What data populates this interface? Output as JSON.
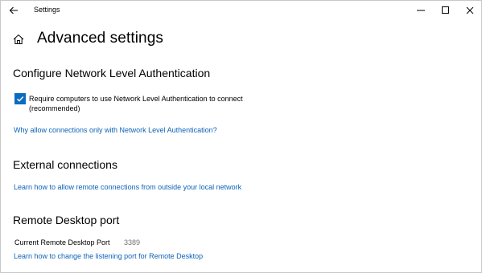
{
  "window": {
    "title": "Settings"
  },
  "page": {
    "title": "Advanced settings"
  },
  "nla": {
    "heading": "Configure Network Level Authentication",
    "checkbox_label": "Require computers to use Network Level Authentication to connect (recommended)",
    "checked": true,
    "link": "Why allow connections only with Network Level Authentication?"
  },
  "external": {
    "heading": "External connections",
    "link": "Learn how to allow remote connections from outside your local network"
  },
  "rdp_port": {
    "heading": "Remote Desktop port",
    "label": "Current Remote Desktop Port",
    "value": "3389",
    "link": "Learn how to change the listening port for Remote Desktop"
  },
  "colors": {
    "accent": "#0b6cbf",
    "link": "#0b62b8"
  },
  "icons": [
    "back-arrow-icon",
    "minimize-icon",
    "maximize-icon",
    "close-icon",
    "home-icon",
    "checkmark-icon"
  ]
}
